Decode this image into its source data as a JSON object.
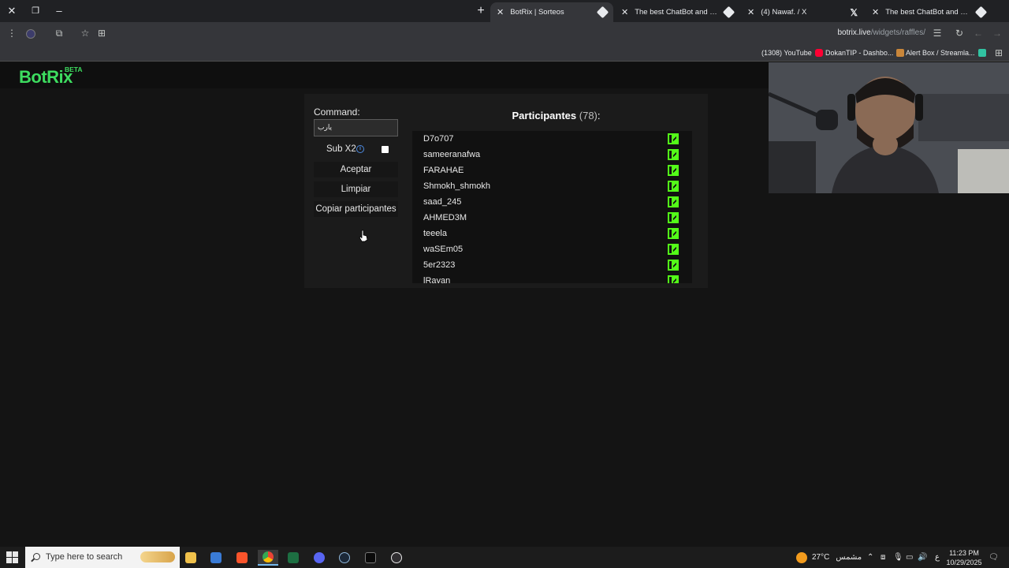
{
  "browser": {
    "tabs": [
      {
        "label": "BotRix | Sorteos",
        "active": true
      },
      {
        "label": "The best ChatBot and Widgets",
        "active": false
      },
      {
        "label": "(4) Nawaf. / X",
        "active": false
      },
      {
        "label": "The best ChatBot and Widgets",
        "active": false
      }
    ],
    "url_host": "botrix.live",
    "url_path": "/widgets/raffles/",
    "bookmarks": [
      {
        "label": "(1308) YouTube",
        "color": "#ff0033"
      },
      {
        "label": "DokanTIP - Dashbo...",
        "color": "#c9863a"
      },
      {
        "label": "Alert Box / Streamla...",
        "color": "#31c3a2"
      }
    ]
  },
  "site": {
    "logo": "BotRix",
    "badge": "BETA"
  },
  "raffle": {
    "command_label": "Command:",
    "command_value": "يارب",
    "sub_label": "Sub X2",
    "sub_checked": false,
    "buttons": {
      "accept": "Aceptar",
      "clear": "Limpiar",
      "copy": "Copiar participantes"
    },
    "participants_title": "Participantes",
    "participants_count": "(78)",
    "participants_colon": ":",
    "participants": [
      "D7o707",
      "sameeranafwa",
      "FARAHAE",
      "Shmokh_shmokh",
      "saad_245",
      "AHMED3M",
      "teeela",
      "waSEm05",
      "5er2323",
      "lRayan"
    ]
  },
  "taskbar": {
    "search_placeholder": "Type here to search",
    "weather": "27°C",
    "weather_desc": "مشمس",
    "lang": "ع",
    "time": "11:23 PM",
    "date": "10/29/2025"
  },
  "colors": {
    "accent": "#3ddc5f",
    "kick": "#53fc18"
  }
}
